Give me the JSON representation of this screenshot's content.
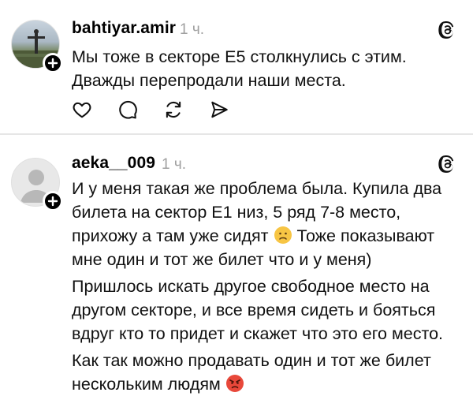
{
  "posts": [
    {
      "username": "bahtiyar.amir",
      "time": "1 ч.",
      "paragraphs": [
        "Мы тоже в секторе Е5 столкнулись с этим.",
        "Дважды перепродали наши места."
      ],
      "avatar": "photo-avatar"
    },
    {
      "username": "aeka__009",
      "time": "1 ч.",
      "paragraphs": [
        "И  у меня такая же проблема была. Купила два билета на сектор Е1 низ, 5 ряд 7-8 место, прихожу а там уже сидят",
        "Тоже показывают мне один и тот же билет что и у меня)",
        "Пришлось искать другое свободное место на другом секторе, и все время сидеть и бояться вдруг кто то придет и скажет что это его место.",
        "Как так можно продавать один и тот же билет нескольким людям"
      ],
      "avatar": "default-avatar"
    }
  ],
  "icons": {
    "like": "heart-icon",
    "comment": "comment-icon",
    "repost": "repost-icon",
    "share": "send-icon",
    "threads": "threads-logo-icon",
    "follow": "plus-icon",
    "sad_emoji": "frowning-face-emoji",
    "angry_emoji": "angry-face-emoji"
  },
  "colors": {
    "text": "#111111",
    "muted": "#a0a0a0",
    "divider": "#e6e6e6"
  }
}
